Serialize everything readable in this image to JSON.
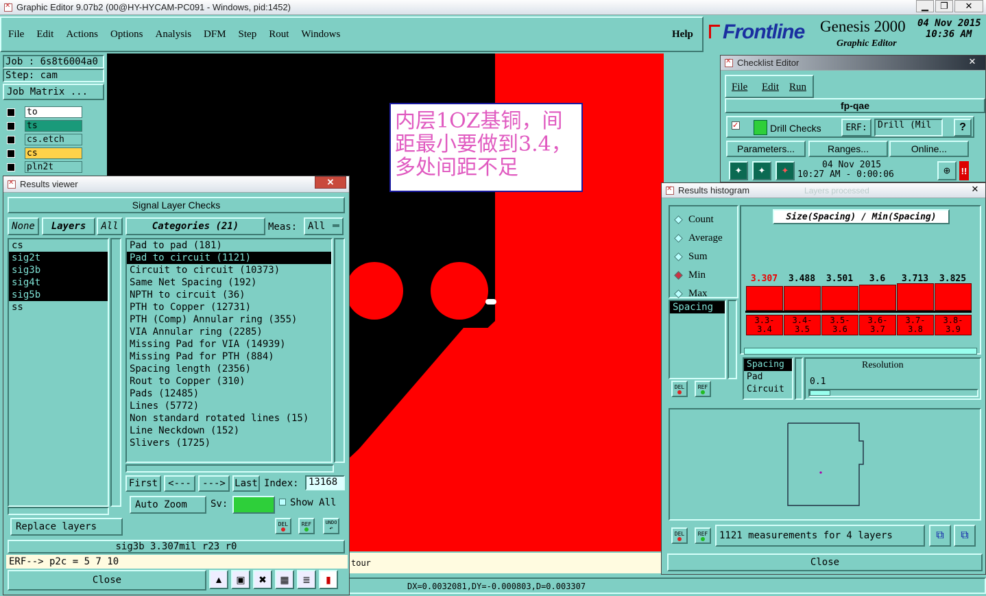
{
  "app": {
    "title": "Graphic Editor 9.07b2 (00@HY-HYCAM-PC091 - Windows, pid:1452)",
    "menu": [
      "File",
      "Edit",
      "Actions",
      "Options",
      "Analysis",
      "DFM",
      "Step",
      "Rout",
      "Windows"
    ],
    "help": "Help",
    "brand": "Frontline",
    "product": "Genesis 2000",
    "subtitle": "Graphic Editor",
    "date": "04 Nov 2015",
    "time": "10:36 AM"
  },
  "job": {
    "job_label": "Job :",
    "job_value": "6s8t6004a0",
    "step_label": "Step:",
    "step_value": "cam",
    "matrix_btn": "Job Matrix ...",
    "layers": [
      {
        "name": "to",
        "color": "#ffffff"
      },
      {
        "name": "ts",
        "color": "#1a9a7a"
      },
      {
        "name": "cs.etch",
        "color": "#7fcfc4"
      },
      {
        "name": "cs",
        "color": "#ffd24a"
      },
      {
        "name": "pln2t",
        "color": "#7fcfc4"
      }
    ]
  },
  "annotation": {
    "text": "内层1OZ基铜，间距最小要做到3.4，多处间距不足"
  },
  "canvas": {
    "bottom_text": "tour",
    "status": "DX=0.0032081,DY=-0.000803,D=0.003307"
  },
  "results_viewer": {
    "title": "Results viewer",
    "heading": "Signal Layer Checks",
    "none": "None",
    "layers": "Layers",
    "all": "All",
    "categories": "Categories (21)",
    "meas_label": "Meas:",
    "meas_value": "All",
    "layer_list": [
      {
        "name": "cs",
        "sel": false
      },
      {
        "name": "sig2t",
        "sel": true
      },
      {
        "name": "sig3b",
        "sel": true
      },
      {
        "name": "sig4t",
        "sel": true
      },
      {
        "name": "sig5b",
        "sel": true
      },
      {
        "name": "ss",
        "sel": false
      }
    ],
    "cat_list": [
      {
        "name": "Pad to pad (181)",
        "sel": false
      },
      {
        "name": "Pad to circuit (1121)",
        "sel": true
      },
      {
        "name": "Circuit to circuit (10373)",
        "sel": false
      },
      {
        "name": "Same Net Spacing (192)",
        "sel": false
      },
      {
        "name": "NPTH to circuit (36)",
        "sel": false
      },
      {
        "name": "PTH to Copper (12731)",
        "sel": false
      },
      {
        "name": "PTH (Comp) Annular ring (355)",
        "sel": false
      },
      {
        "name": "VIA Annular ring (2285)",
        "sel": false
      },
      {
        "name": "Missing Pad for VIA (14939)",
        "sel": false
      },
      {
        "name": "Missing Pad for PTH (884)",
        "sel": false
      },
      {
        "name": "Spacing length (2356)",
        "sel": false
      },
      {
        "name": "Rout to Copper (310)",
        "sel": false
      },
      {
        "name": "Pads (12485)",
        "sel": false
      },
      {
        "name": "Lines (5772)",
        "sel": false
      },
      {
        "name": "Non standard rotated lines (15)",
        "sel": false
      },
      {
        "name": "Line Neckdown (152)",
        "sel": false
      },
      {
        "name": "Slivers (1725)",
        "sel": false
      }
    ],
    "first": "First",
    "prev": "<---",
    "next": "--->",
    "last": "Last",
    "index_label": "Index:",
    "index_value": "13168",
    "auto_zoom": "Auto Zoom",
    "sv_label": "Sv:",
    "show_all": "Show All",
    "replace_layers": "Replace layers",
    "del": "DEL",
    "ref": "REF",
    "undo": "UNDO",
    "info": "sig3b 3.307mil   r23   r0",
    "erf": "ERF--> p2c = 5 7 10",
    "close": "Close"
  },
  "checklist": {
    "title": "Checklist Editor",
    "menu": [
      "File",
      "Edit",
      "Run"
    ],
    "name": "fp-qae",
    "check": "Drill Checks",
    "erf_label": "ERF:",
    "erf_value": "Drill (Mil",
    "params": "Parameters...",
    "ranges": "Ranges...",
    "online": "Online...",
    "date": "04 Nov 2015",
    "time": "10:27 AM - 0:00:06",
    "faded": "Layers processed"
  },
  "histogram": {
    "title": "Results histogram",
    "options": [
      {
        "name": "Count",
        "sel": false
      },
      {
        "name": "Average",
        "sel": false
      },
      {
        "name": "Sum",
        "sel": false
      },
      {
        "name": "Min",
        "sel": true
      },
      {
        "name": "Max",
        "sel": false
      }
    ],
    "chart_title": "Size(Spacing) / Min(Spacing)",
    "spacing_item": "Spacing",
    "bars": [
      {
        "value": "3.307",
        "range": "3.3-3.4",
        "red": true
      },
      {
        "value": "3.488",
        "range": "3.4-3.5",
        "red": false
      },
      {
        "value": "3.501",
        "range": "3.5-3.6",
        "red": false
      },
      {
        "value": "3.6",
        "range": "3.6-3.7",
        "red": false
      },
      {
        "value": "3.713",
        "range": "3.7-3.8",
        "red": false
      },
      {
        "value": "3.825",
        "range": "3.8-3.9",
        "red": false
      }
    ],
    "measure_list": [
      {
        "name": "Spacing",
        "sel": true
      },
      {
        "name": "Pad",
        "sel": false
      },
      {
        "name": "Circuit",
        "sel": false
      }
    ],
    "resolution_label": "Resolution",
    "resolution_value": "0.1",
    "summary": "1121 measurements for 4 layers",
    "close": "Close"
  }
}
